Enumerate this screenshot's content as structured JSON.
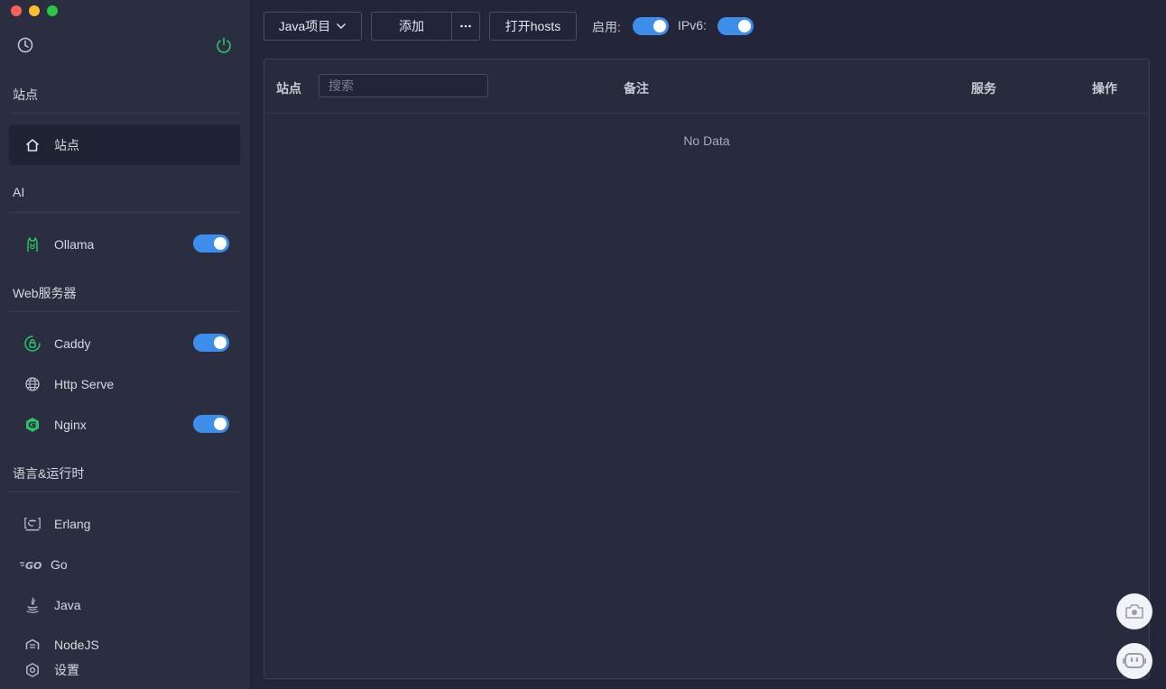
{
  "sidebar": {
    "groups": [
      {
        "title": "站点",
        "items": [
          {
            "label": "站点",
            "icon": "home-icon"
          }
        ]
      },
      {
        "title": "AI",
        "items": [
          {
            "label": "Ollama",
            "icon": "ollama-icon",
            "enabled": true
          }
        ]
      },
      {
        "title": "Web服务器",
        "items": [
          {
            "label": "Caddy",
            "icon": "caddy-icon",
            "enabled": true
          },
          {
            "label": "Http Serve",
            "icon": "globe-icon"
          },
          {
            "label": "Nginx",
            "icon": "nginx-icon",
            "enabled": true
          }
        ]
      },
      {
        "title": "语言&运行时",
        "items": [
          {
            "label": "Erlang",
            "icon": "erlang-icon"
          },
          {
            "label": "Go",
            "icon": "go-icon"
          },
          {
            "label": "Java",
            "icon": "java-icon"
          },
          {
            "label": "NodeJS",
            "icon": "nodejs-icon"
          }
        ]
      }
    ],
    "settings_label": "设置"
  },
  "toolbar": {
    "project_select": "Java项目",
    "add_label": "添加",
    "open_hosts_label": "打开hosts",
    "enable_label": "启用:",
    "ipv6_label": "IPv6:",
    "enable_on": true,
    "ipv6_on": true
  },
  "table": {
    "site_header": "站点",
    "search_placeholder": "搜索",
    "columns": [
      "备注",
      "服务",
      "操作"
    ],
    "empty_text": "No Data"
  },
  "colors": {
    "accent": "#3d8eea",
    "sidebar_bg": "#2b2e40",
    "main_bg": "#232638",
    "green_icon": "#2bc26b"
  }
}
